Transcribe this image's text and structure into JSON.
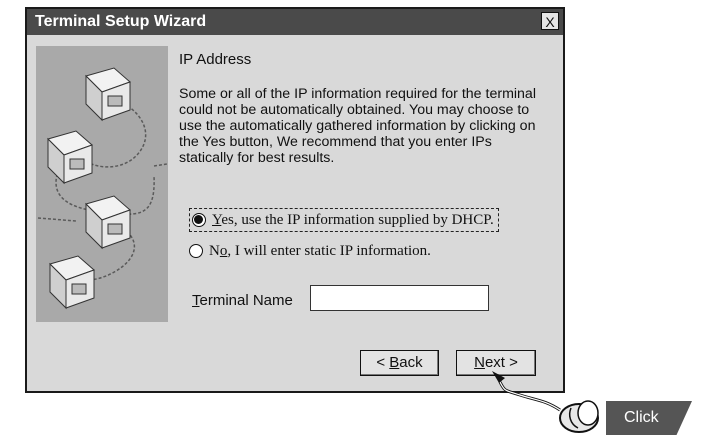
{
  "window": {
    "title": "Terminal Setup Wizard",
    "close_label": "X"
  },
  "content": {
    "heading": "IP Address",
    "description": "Some or all of the IP information required for the terminal could not be automatically obtained. You may choose to use the automatically gathered information by clicking on the Yes button, We recommend that you enter IPs statically for best results."
  },
  "options": [
    {
      "accel": "Y",
      "rest": "es, use the IP information supplied by DHCP.",
      "checked": true
    },
    {
      "pre": "N",
      "accel": "o",
      "rest": ", I will enter static IP information.",
      "checked": false
    }
  ],
  "terminal_name": {
    "accel": "T",
    "rest": "erminal Name",
    "value": ""
  },
  "buttons": {
    "back_pre": "< ",
    "back_accel": "B",
    "back_rest": "ack",
    "next_accel": "N",
    "next_rest": "ext >"
  },
  "callout": {
    "label": "Click"
  }
}
